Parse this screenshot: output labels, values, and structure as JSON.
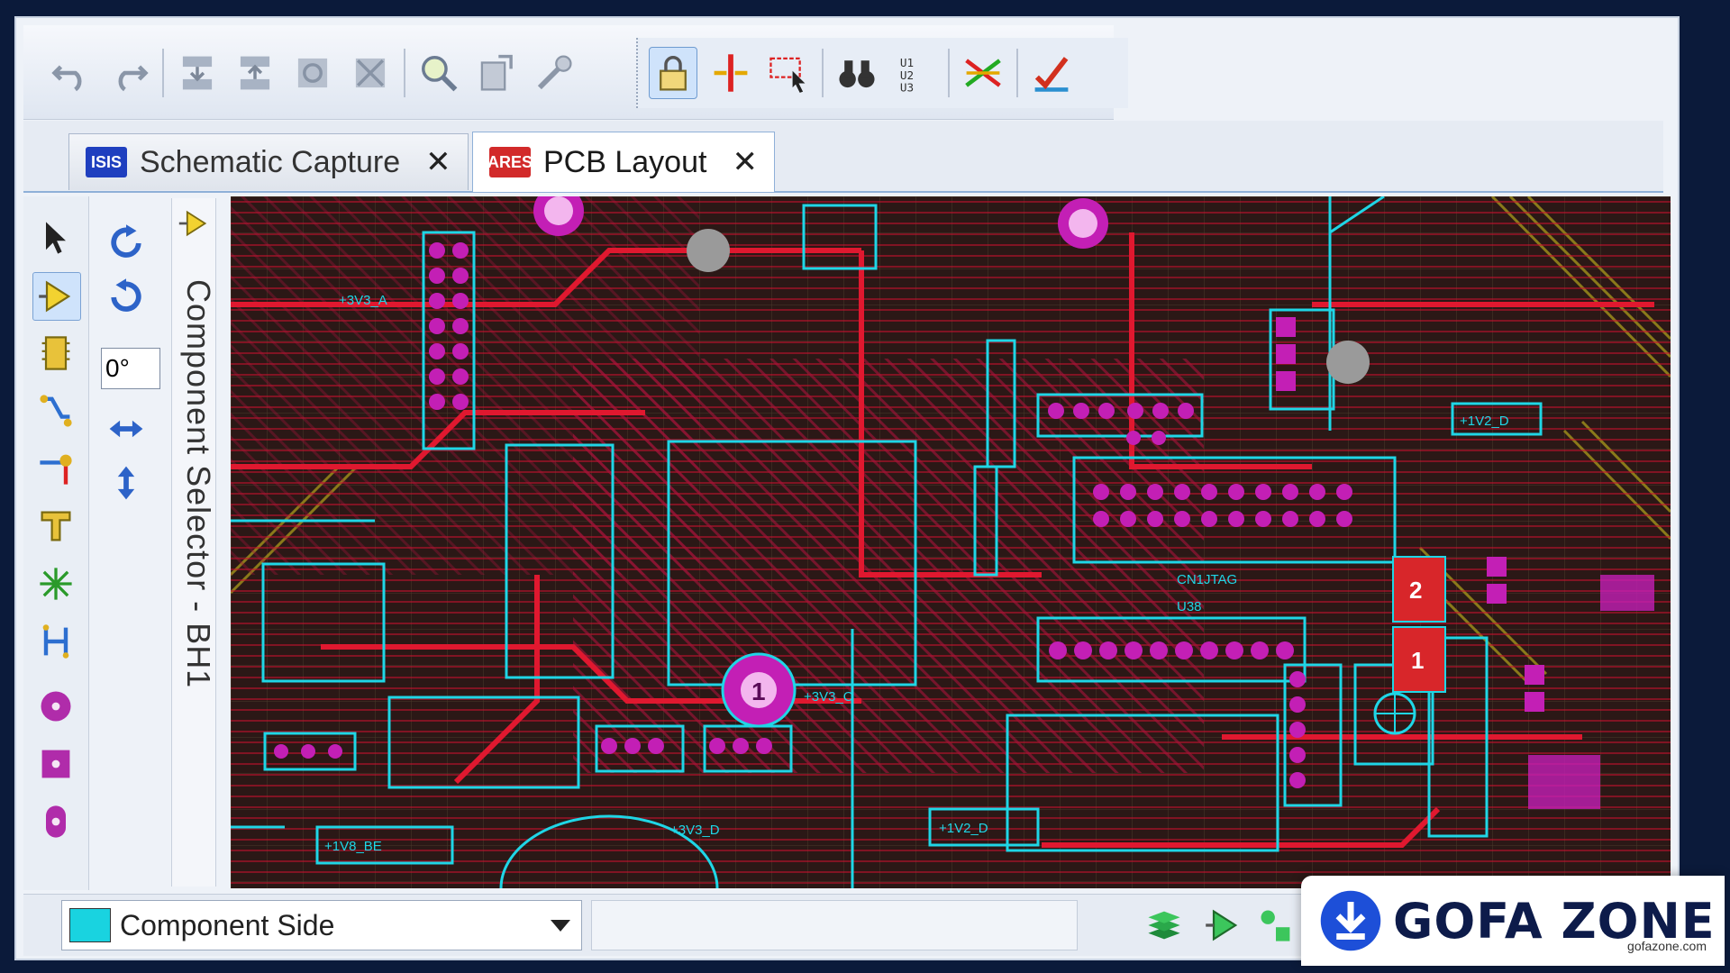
{
  "toolbar": {
    "group1": [
      {
        "name": "undo-icon"
      },
      {
        "name": "redo-icon"
      },
      {
        "name": "block-copy-icon"
      },
      {
        "name": "block-move-icon"
      },
      {
        "name": "block-rotate-icon"
      },
      {
        "name": "block-delete-icon"
      },
      {
        "name": "zoom-search-icon"
      },
      {
        "name": "import-icon"
      },
      {
        "name": "tools-icon"
      }
    ],
    "group2": [
      {
        "name": "lock-icon",
        "active": true
      },
      {
        "name": "split-icon"
      },
      {
        "name": "select-area-icon"
      },
      {
        "name": "binoculars-icon"
      },
      {
        "name": "netlist-icon"
      },
      {
        "name": "ratsnest-icon"
      },
      {
        "name": "drc-check-icon"
      }
    ]
  },
  "tabs": [
    {
      "label": "Schematic Capture",
      "badge": "ISIS",
      "badge_color": "#1f3fbf",
      "active": false
    },
    {
      "label": "PCB Layout",
      "badge": "ARES",
      "badge_color": "#d22a2a",
      "active": true
    }
  ],
  "rotation": {
    "angle_value": "0°"
  },
  "selector": {
    "label": "Component Selector - BH1"
  },
  "pcb_labels": {
    "pad2": "2",
    "pad1": "1",
    "via1": "1",
    "header_label": "CN1JTAG",
    "u_label": "U38",
    "net_a": "+3V3_D",
    "net_b": "+1V2_D",
    "net_c": "+3V3_C",
    "net_d": "+1V2_D",
    "net_e": "+3V3_A",
    "net_f": "+1V8_BE"
  },
  "status": {
    "layer_label": "Component Side",
    "layer_color": "#19d3e0"
  },
  "watermark": {
    "brand": "GOFA ZONE",
    "domain": "gofazone.com"
  }
}
